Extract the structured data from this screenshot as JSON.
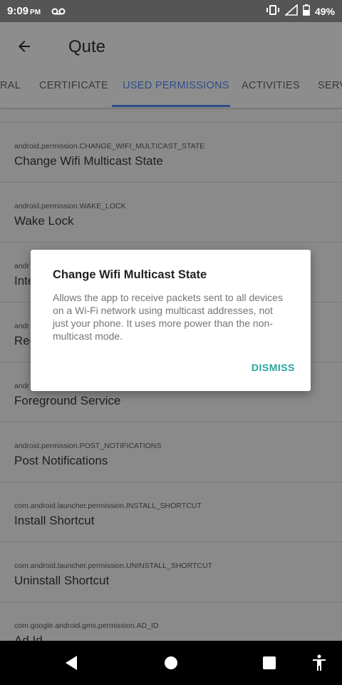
{
  "status_bar": {
    "time": "9:09",
    "ampm": "PM",
    "battery": "49%"
  },
  "app_bar": {
    "title": "Qute"
  },
  "tabs": [
    {
      "label": "RAL"
    },
    {
      "label": "CERTIFICATE"
    },
    {
      "label": "USED PERMISSIONS"
    },
    {
      "label": "ACTIVITIES"
    },
    {
      "label": "SERV"
    }
  ],
  "permissions": [
    {
      "name": "android.permission.CHANGE_WIFI_MULTICAST_STATE",
      "label": "Change Wifi Multicast State"
    },
    {
      "name": "android.permission.WAKE_LOCK",
      "label": "Wake Lock"
    },
    {
      "name": "andr",
      "label": "Inte"
    },
    {
      "name": "andr",
      "label": "Rec"
    },
    {
      "name": "andr",
      "label": "Foreground Service"
    },
    {
      "name": "android.permission.POST_NOTIFICATIONS",
      "label": "Post Notifications"
    },
    {
      "name": "com.android.launcher.permission.INSTALL_SHORTCUT",
      "label": "Install Shortcut"
    },
    {
      "name": "com.android.launcher.permission.UNINSTALL_SHORTCUT",
      "label": "Uninstall Shortcut"
    },
    {
      "name": "com.google.android.gms.permission.AD_ID",
      "label": "Ad Id"
    }
  ],
  "dialog": {
    "title": "Change Wifi Multicast State",
    "body": "Allows the app to receive packets sent to all devices on a Wi-Fi network using multicast addresses, not just your phone. It uses more power than the non-multicast mode.",
    "dismiss_label": "DISMISS"
  },
  "colors": {
    "accent": "#2c4d8a",
    "dialog_action": "#26a69a",
    "scrim_background": "#8a8a8a"
  }
}
